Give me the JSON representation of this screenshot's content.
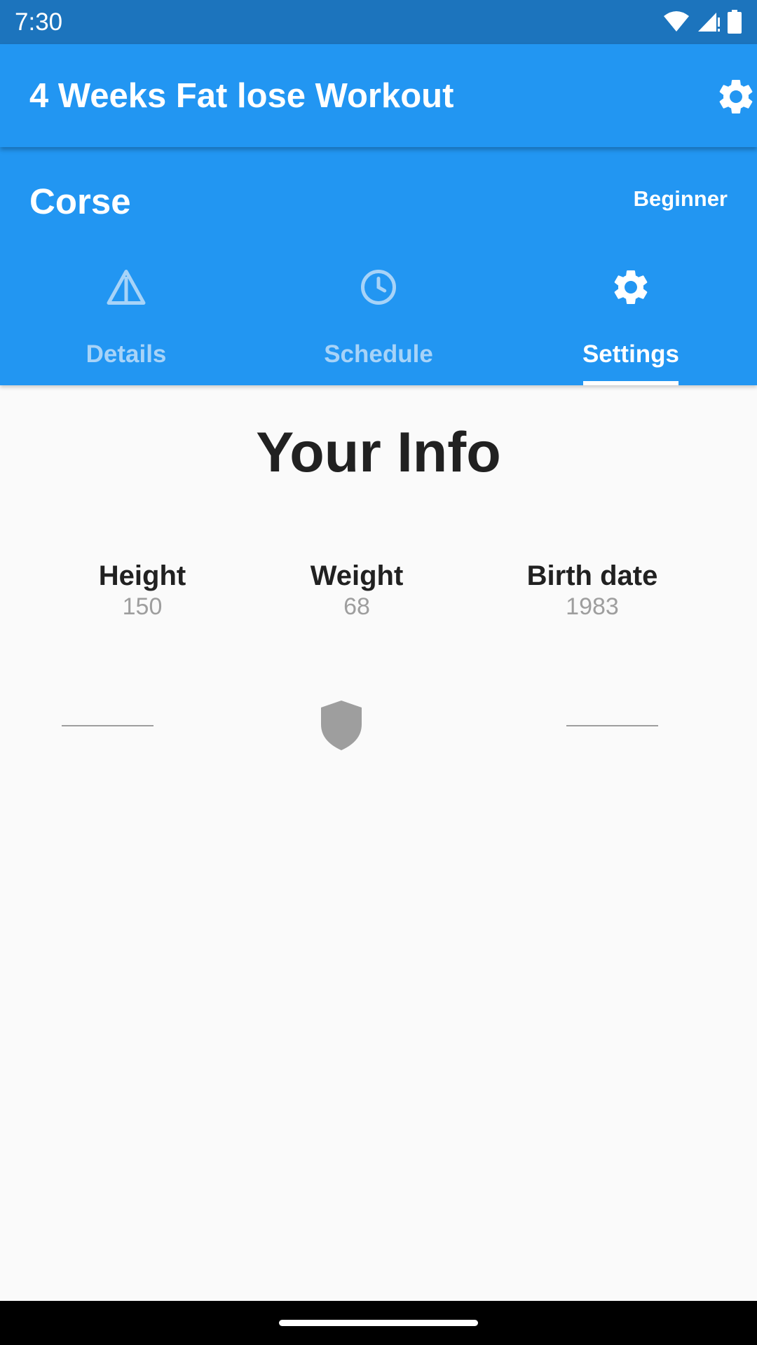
{
  "status_bar": {
    "time": "7:30",
    "icons": [
      "wifi-icon",
      "signal-icon",
      "battery-icon"
    ]
  },
  "app_bar": {
    "title": "4 Weeks Fat lose Workout",
    "settings_icon": "gear-icon"
  },
  "header": {
    "course_label": "Corse",
    "level": "Beginner"
  },
  "tabs": [
    {
      "label": "Details",
      "icon": "triangle-warning-icon",
      "active": false
    },
    {
      "label": "Schedule",
      "icon": "clock-icon",
      "active": false
    },
    {
      "label": "Settings",
      "icon": "gear-icon",
      "active": true
    }
  ],
  "main": {
    "title": "Your Info",
    "info": [
      {
        "label": "Height",
        "value": "150"
      },
      {
        "label": "Weight",
        "value": "68"
      },
      {
        "label": "Birth date",
        "value": "1983"
      }
    ],
    "shield_icon": "shield-icon"
  },
  "colors": {
    "primary": "#2296f2",
    "status_bar": "#1c74bd",
    "tab_inactive": "#a7d3f8",
    "text_dark": "#212121",
    "text_muted": "#9e9e9e"
  }
}
